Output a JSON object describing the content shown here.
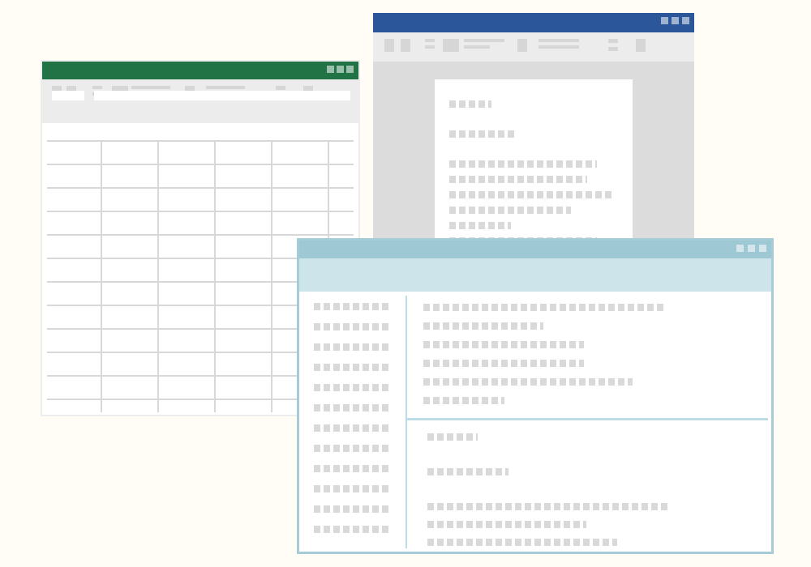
{
  "windows": {
    "spreadsheet": {
      "accent": "#217346",
      "row_count": 12,
      "column_count": 6
    },
    "document": {
      "accent": "#2b579a"
    },
    "browser": {
      "accent": "#9fc8d5",
      "address_bar_color": "#cde5ea",
      "sidebar_item_count": 12
    }
  },
  "placeholder_color": "#d9d9d9",
  "window_controls": [
    "minimize",
    "maximize",
    "close"
  ]
}
